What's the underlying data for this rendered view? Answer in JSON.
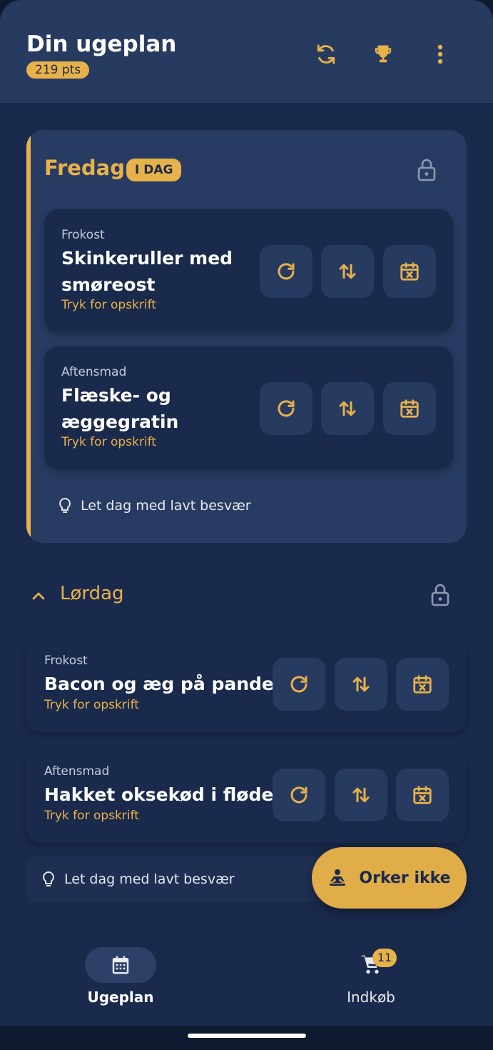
{
  "header": {
    "title": "Din ugeplan",
    "points": "219 pts",
    "icons": [
      "refresh-icon",
      "trophy-icon",
      "more-vert-icon"
    ]
  },
  "days": [
    {
      "name": "Fredag",
      "badge": "I DAG",
      "locked": true,
      "meals": [
        {
          "type": "Frokost",
          "name": "Skinkeruller med smøreost",
          "link": "Tryk for opskrift"
        },
        {
          "type": "Aftensmad",
          "name": "Flæske- og æggegratin",
          "link": "Tryk for opskrift"
        }
      ],
      "tip": "Let dag med lavt besvær"
    },
    {
      "name": "Lørdag",
      "locked": true,
      "meals": [
        {
          "type": "Frokost",
          "name": "Bacon og æg på panden",
          "link": "Tryk for opskrift"
        },
        {
          "type": "Aftensmad",
          "name": "Hakket oksekød i fløde",
          "link": "Tryk for opskrift"
        }
      ],
      "tip": "Let dag med lavt besvær"
    }
  ],
  "fab": {
    "label": "Orker ikke",
    "icon": "meditation-icon"
  },
  "nav": [
    {
      "label": "Ugeplan",
      "icon": "calendar-icon",
      "active": true
    },
    {
      "label": "Indkøb",
      "icon": "cart-icon",
      "badge": "11"
    }
  ],
  "colors": {
    "accent": "#e8b24a",
    "background": "#1a2a4c",
    "card": "#283b62"
  }
}
